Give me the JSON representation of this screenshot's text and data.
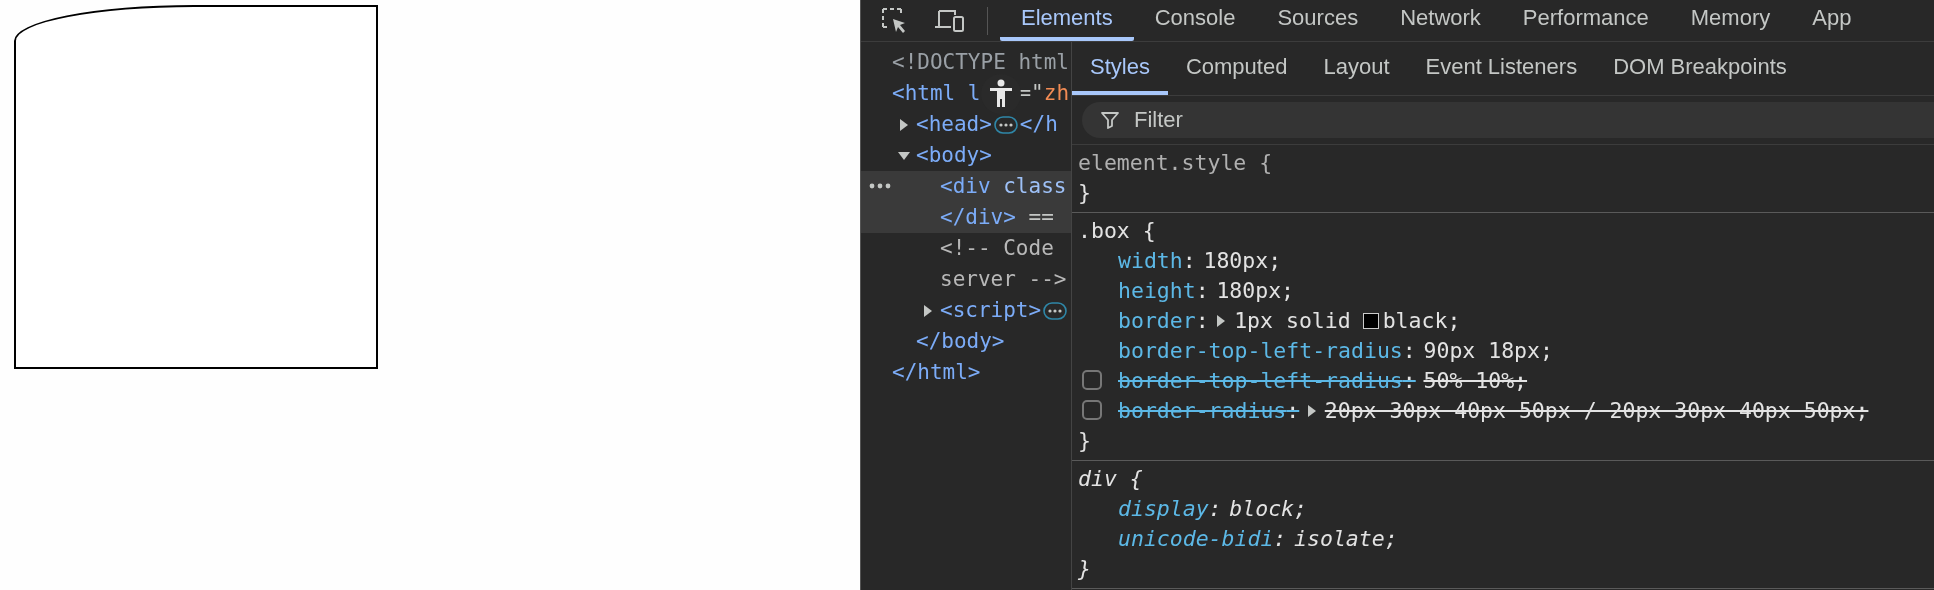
{
  "devtools": {
    "tabs": [
      {
        "label": "Elements",
        "selected": true
      },
      {
        "label": "Console",
        "selected": false
      },
      {
        "label": "Sources",
        "selected": false
      },
      {
        "label": "Network",
        "selected": false
      },
      {
        "label": "Performance",
        "selected": false
      },
      {
        "label": "Memory",
        "selected": false
      },
      {
        "label": "App",
        "selected": false
      }
    ],
    "elements": {
      "nodes": [
        {
          "selected": false,
          "lines": [
            [
              {
                "kind": "doctype",
                "text": "<!DOCTYPE html"
              }
            ]
          ]
        },
        {
          "selected": false,
          "lines": [
            [
              {
                "kind": "tag",
                "text": "<html l"
              },
              {
                "kind": "accessibility"
              },
              {
                "kind": "punct",
                "text": "=\""
              },
              {
                "kind": "value",
                "text": "zh"
              }
            ]
          ],
          "children": [
            {
              "selected": false,
              "expanded": false,
              "lines": [
                [
                  {
                    "kind": "tag",
                    "text": "<head>"
                  },
                  {
                    "kind": "ellipsis"
                  },
                  {
                    "kind": "tag",
                    "text": "</h"
                  }
                ]
              ]
            },
            {
              "selected": false,
              "expanded": true,
              "lines": [
                [
                  {
                    "kind": "tag",
                    "text": "<body>"
                  }
                ]
              ],
              "children": [
                {
                  "selected": true,
                  "lines": [
                    [
                      {
                        "kind": "tag",
                        "text": "<div"
                      },
                      {
                        "kind": "attr",
                        "text": " class"
                      }
                    ],
                    [
                      {
                        "kind": "tag",
                        "text": "</div>"
                      },
                      {
                        "kind": "punct",
                        "text": " =="
                      }
                    ]
                  ]
                },
                {
                  "selected": false,
                  "lines": [
                    [
                      {
                        "kind": "comment",
                        "text": "<!-- Code"
                      }
                    ],
                    [
                      {
                        "kind": "comment",
                        "text": "server -->"
                      }
                    ]
                  ]
                },
                {
                  "selected": false,
                  "expanded": false,
                  "lines": [
                    [
                      {
                        "kind": "tag",
                        "text": "<script>"
                      },
                      {
                        "kind": "ellipsis"
                      }
                    ]
                  ]
                }
              ],
              "close": [
                {
                  "kind": "tag",
                  "text": "</body>"
                }
              ]
            }
          ],
          "close": [
            {
              "kind": "tag",
              "text": "</html>"
            }
          ]
        }
      ]
    },
    "sidebar": {
      "tabs": [
        {
          "label": "Styles",
          "selected": true
        },
        {
          "label": "Computed",
          "selected": false
        },
        {
          "label": "Layout",
          "selected": false
        },
        {
          "label": "Event Listeners",
          "selected": false
        },
        {
          "label": "DOM Breakpoints",
          "selected": false
        }
      ],
      "filter": {
        "placeholder": "Filter"
      },
      "rules": [
        {
          "selector": "element.style",
          "kind": "inline",
          "brace_open": "{",
          "brace_close": "}"
        },
        {
          "selector": ".box",
          "kind": "author",
          "brace_open": "{",
          "brace_close": "}",
          "properties": [
            {
              "name": "width",
              "colon": ":",
              "value": "180px;",
              "checked": true
            },
            {
              "name": "height",
              "colon": ":",
              "value": "180px;",
              "checked": true
            },
            {
              "name": "border",
              "colon": ":",
              "expanded": false,
              "value": "1px solid",
              "swatch": {
                "color": "#000000"
              },
              "value_after": "black;",
              "checked": true
            },
            {
              "name": "border-top-left-radius",
              "colon": ":",
              "value": "90px 18px;",
              "checked": true
            },
            {
              "name": "border-top-left-radius",
              "colon": ":",
              "value": "50% 10%;",
              "checked": false
            },
            {
              "name": "border-radius",
              "colon": ":",
              "expanded": false,
              "value": "20px 30px 40px 50px / 20px 30px 40px 50px;",
              "checked": false
            }
          ]
        },
        {
          "selector": "div",
          "kind": "user-agent",
          "brace_open": "{",
          "brace_close": "}",
          "properties": [
            {
              "name": "display",
              "colon": ":",
              "value": "block;",
              "checked": true
            },
            {
              "name": "unicode-bidi",
              "colon": ":",
              "value": "isolate;",
              "checked": true
            }
          ]
        }
      ]
    }
  }
}
